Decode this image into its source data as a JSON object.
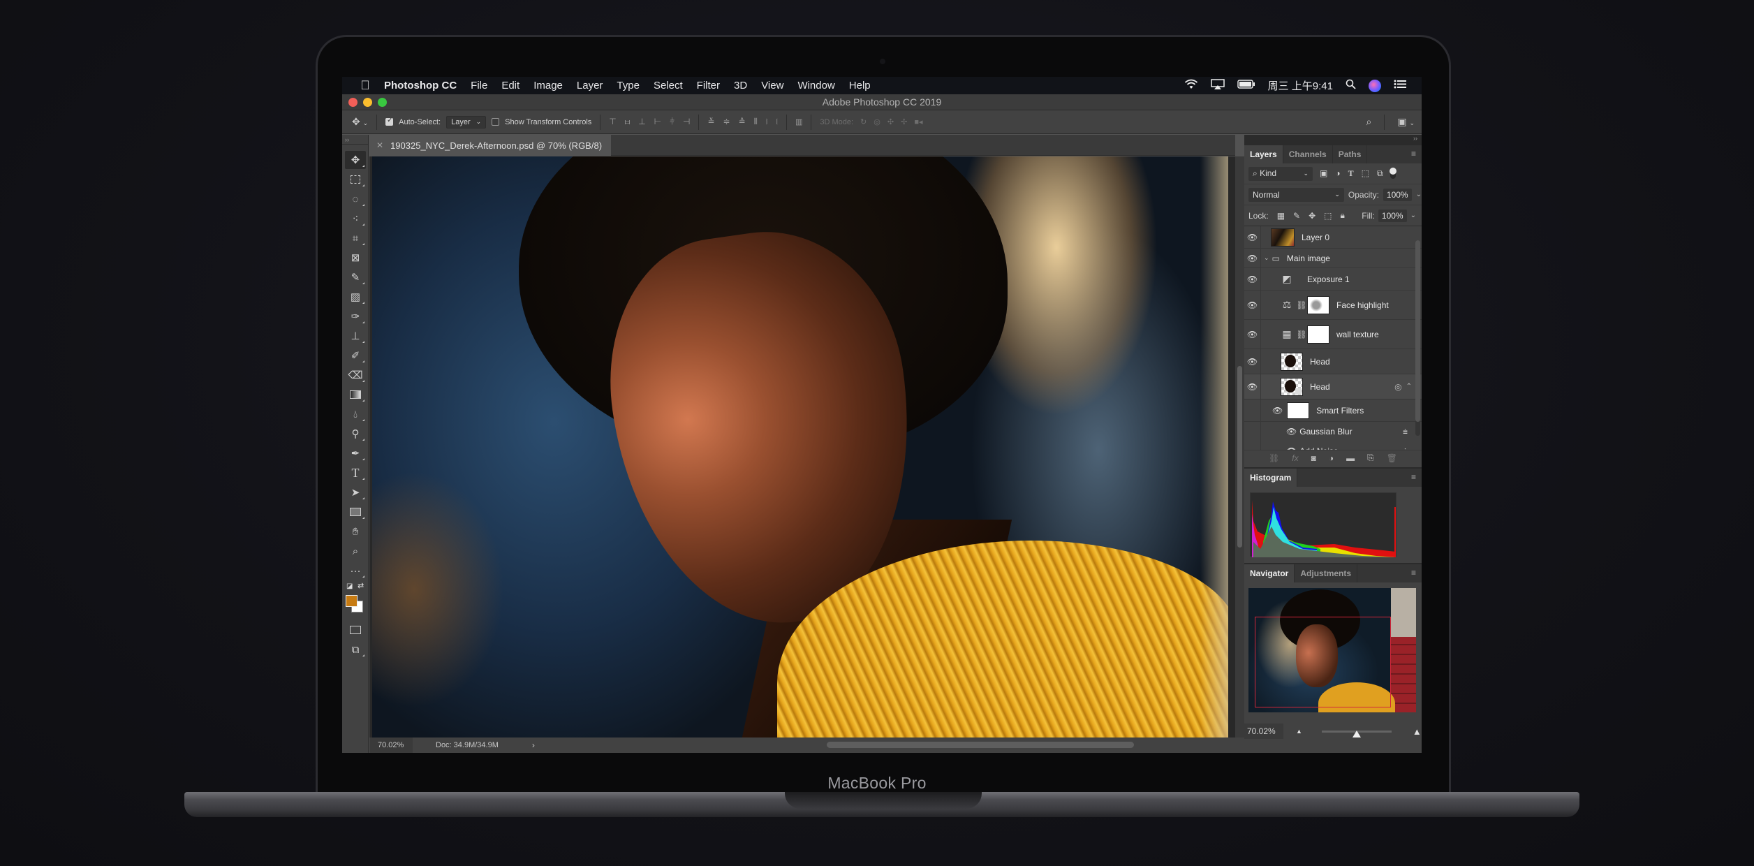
{
  "device": {
    "label": "MacBook Pro"
  },
  "menubar": {
    "app_name": "Photoshop CC",
    "items": [
      "File",
      "Edit",
      "Image",
      "Layer",
      "Type",
      "Select",
      "Filter",
      "3D",
      "View",
      "Window",
      "Help"
    ],
    "clock": "周三 上午9:41"
  },
  "window": {
    "title": "Adobe Photoshop CC 2019"
  },
  "options_bar": {
    "auto_select_label": "Auto-Select:",
    "auto_select_checked": true,
    "auto_select_target": "Layer",
    "show_transform_label": "Show Transform Controls",
    "show_transform_checked": false,
    "mode_3d_label": "3D Mode:"
  },
  "document": {
    "tab_title": "190325_NYC_Derek-Afternoon.psd @ 70% (RGB/8)",
    "zoom": "70.02%",
    "doc_size": "Doc: 34.9M/34.9M"
  },
  "tools": [
    "move",
    "rectangular-marquee",
    "lasso",
    "quick-selection",
    "crop",
    "frame",
    "eyedropper",
    "healing-brush",
    "brush",
    "clone-stamp",
    "history-brush",
    "eraser",
    "gradient",
    "blur",
    "dodge",
    "pen",
    "type",
    "path-selection",
    "rectangle",
    "hand",
    "zoom",
    "more"
  ],
  "colors": {
    "foreground": "#c77b12",
    "background": "#ffffff"
  },
  "layers_panel": {
    "tabs": [
      "Layers",
      "Channels",
      "Paths"
    ],
    "active_tab": "Layers",
    "filter_kind": "Kind",
    "blend_mode": "Normal",
    "opacity_label": "Opacity:",
    "opacity": "100%",
    "lock_label": "Lock:",
    "fill_label": "Fill:",
    "fill": "100%",
    "layers": [
      {
        "name": "Layer 0",
        "visible": true,
        "type": "pixel"
      },
      {
        "name": "Main image",
        "visible": true,
        "type": "group",
        "expanded": true
      },
      {
        "name": "Exposure 1",
        "visible": true,
        "type": "adjustment-exposure"
      },
      {
        "name": "Face highlight",
        "visible": true,
        "type": "adjustment-color-balance"
      },
      {
        "name": "wall texture",
        "visible": true,
        "type": "adjustment-curves"
      },
      {
        "name": "Head",
        "visible": true,
        "type": "pixel"
      },
      {
        "name": "Head",
        "visible": true,
        "type": "smart-object"
      },
      {
        "name": "Smart Filters",
        "visible": true,
        "type": "smart-filters"
      },
      {
        "name": "Gaussian Blur",
        "visible": true,
        "type": "filter"
      },
      {
        "name": "Add Noise",
        "visible": true,
        "type": "filter"
      }
    ]
  },
  "histogram_panel": {
    "tabs": [
      "Histogram"
    ],
    "active_tab": "Histogram"
  },
  "navigator_panel": {
    "tabs": [
      "Navigator",
      "Adjustments"
    ],
    "active_tab": "Navigator",
    "zoom": "70.02%",
    "zoom_slider_fraction": 0.5
  }
}
